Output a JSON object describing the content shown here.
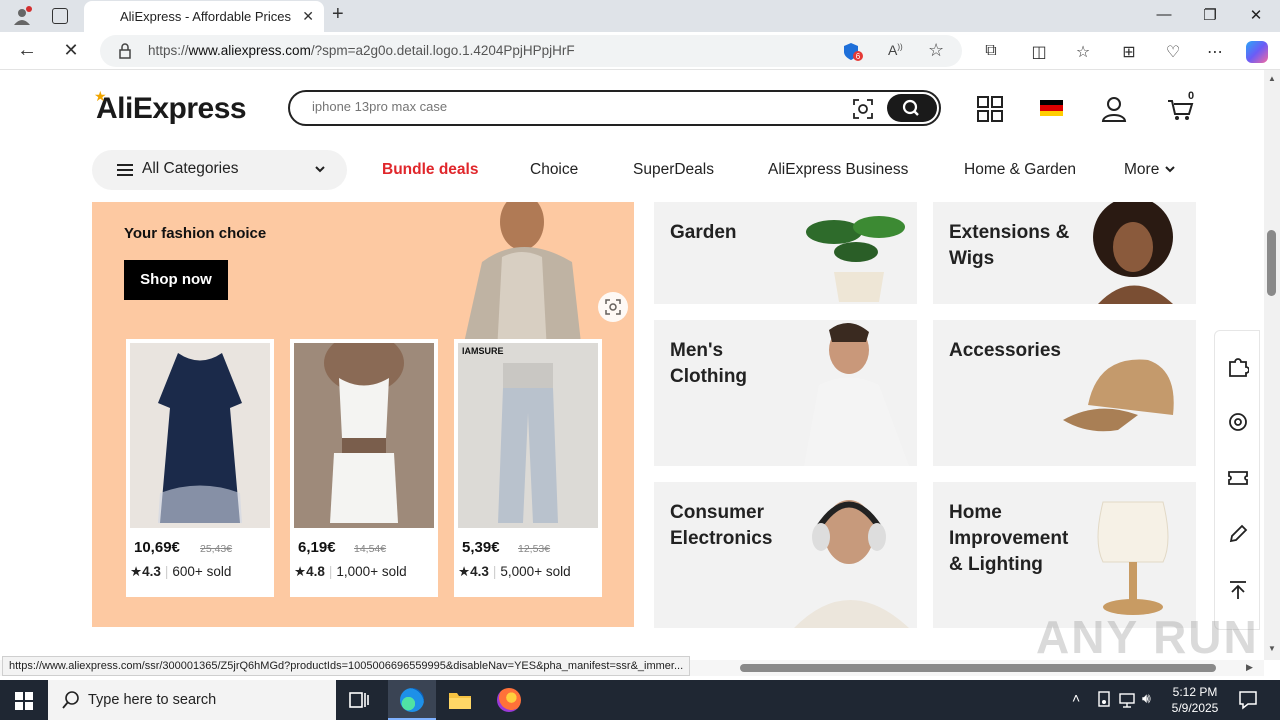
{
  "browser": {
    "tab_title": "AliExpress - Affordable Prices on",
    "url_prefix": "https://",
    "url_host": "www.aliexpress.com",
    "url_rest": "/?spm=a2g0o.detail.logo.1.4204PpjHPpjHrF",
    "status_url": "https://www.aliexpress.com/ssr/300001365/Z5jrQ6hMGd?productIds=1005006696559995&disableNav=YES&pha_manifest=ssr&_immer...",
    "extension_badge": "6"
  },
  "header": {
    "logo": "AliExpress",
    "search_placeholder": "iphone 13pro max case",
    "cart_count": "0"
  },
  "nav": {
    "all_categories": "All Categories",
    "items": [
      "Bundle deals",
      "Choice",
      "SuperDeals",
      "AliExpress Business",
      "Home & Garden",
      "More"
    ]
  },
  "banner": {
    "tagline": "Your fashion choice",
    "shop_now": "Shop now",
    "products": [
      {
        "price": "10,69€",
        "old_price": "25,43€",
        "rating": "4.3",
        "sold": "600+ sold"
      },
      {
        "price": "6,19€",
        "old_price": "14,54€",
        "rating": "4.8",
        "sold": "1,000+ sold"
      },
      {
        "price": "5,39€",
        "old_price": "12,53€",
        "rating": "4.3",
        "sold": "5,000+ sold",
        "brand": "IAMSURE"
      }
    ]
  },
  "categories": [
    {
      "label": "Garden"
    },
    {
      "label": "Extensions &\nWigs"
    },
    {
      "label": "Men's\nClothing"
    },
    {
      "label": "Accessories"
    },
    {
      "label": "Consumer\nElectronics"
    },
    {
      "label": "Home\nImprovement\n& Lighting"
    }
  ],
  "taskbar": {
    "search_placeholder": "Type here to search",
    "time": "5:12 PM",
    "date": "5/9/2025"
  },
  "watermark": "ANY RUN",
  "colors": {
    "accent_red": "#e0262b",
    "banner_bg": "#fdc9a2",
    "tile_bg": "#f2f2f2"
  }
}
